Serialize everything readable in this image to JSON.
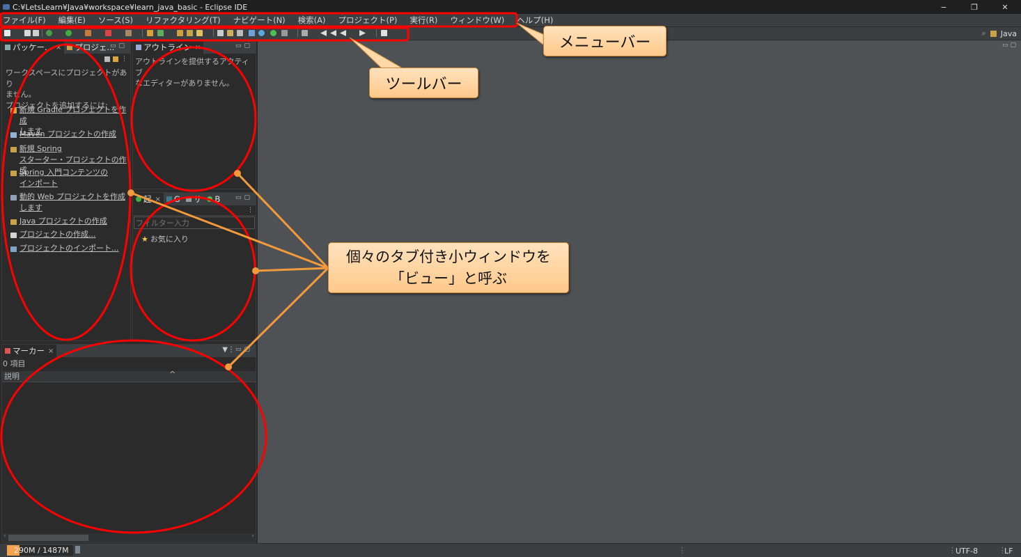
{
  "window": {
    "title": "C:¥LetsLearn¥Java¥workspace¥learn_java_basic - Eclipse IDE",
    "controls": [
      "−",
      "❐",
      "✕"
    ]
  },
  "menubar": {
    "items": [
      "ファイル(F)",
      "編集(E)",
      "ソース(S)",
      "リファクタリング(T)",
      "ナビゲート(N)",
      "検索(A)",
      "プロジェクト(P)",
      "実行(R)",
      "ウィンドウ(W)",
      "ヘルプ(H)"
    ]
  },
  "toolbar": {
    "perspective_label": "Java"
  },
  "package_explorer": {
    "tab_label": "パッケー...",
    "tab2_label": "プロジェ...",
    "message": [
      "ワークスペースにプロジェクトがあり",
      "ません。",
      "プロジェクトを追加するには:"
    ],
    "links": [
      {
        "lines": [
          "新規 Gradle プロジェクトを作成",
          "します"
        ],
        "icon_color": "#d6a23a"
      },
      {
        "lines": [
          "Maven プロジェクトの作成"
        ],
        "icon_color": "#8fb4d8"
      },
      {
        "lines": [
          "新規 Spring",
          "スターター・プロジェクトの作成"
        ],
        "icon_color": "#c9a24a"
      },
      {
        "lines": [
          "Spring 入門コンテンツの",
          "インポート"
        ],
        "icon_color": "#c9a24a"
      },
      {
        "lines": [
          "動的 Web プロジェクトを作成",
          "します"
        ],
        "icon_color": "#8ea0b2"
      },
      {
        "lines": [
          "Java プロジェクトの作成"
        ],
        "icon_color": "#c9a24a"
      },
      {
        "lines": [
          "プロジェクトの作成..."
        ],
        "icon_color": "#d4d4d4"
      },
      {
        "lines": [
          "プロジェクトのインポート..."
        ],
        "icon_color": "#7fa5c9"
      }
    ]
  },
  "outline": {
    "tab_label": "アウトライン",
    "message": [
      "アウトラインを提供するアクティブ",
      "なエディターがありません。"
    ]
  },
  "bottom_left_view": {
    "tabs": [
      "起",
      "G",
      "サ",
      "B"
    ],
    "filter_placeholder": "フィルター入力",
    "favorites_label": "お気に入り"
  },
  "markers": {
    "tab_label": "マーカー",
    "count_label": "0 項目",
    "column_description": "説明",
    "sort_indicator": "^"
  },
  "statusbar": {
    "heap": "290M / 1487M",
    "encoding": "UTF-8",
    "line_ending": "LF"
  },
  "annotations": {
    "menubar_label": "メニューバー",
    "toolbar_label": "ツールバー",
    "views_label_line1": "個々のタブ付き小ウィンドウを",
    "views_label_line2": "「ビュー」と呼ぶ"
  },
  "colors": {
    "annotation_red": "#ff0000",
    "annotation_orange": "#f39a3c",
    "editor_bg": "#4f5254",
    "panel_bg": "#2b2b2b"
  }
}
